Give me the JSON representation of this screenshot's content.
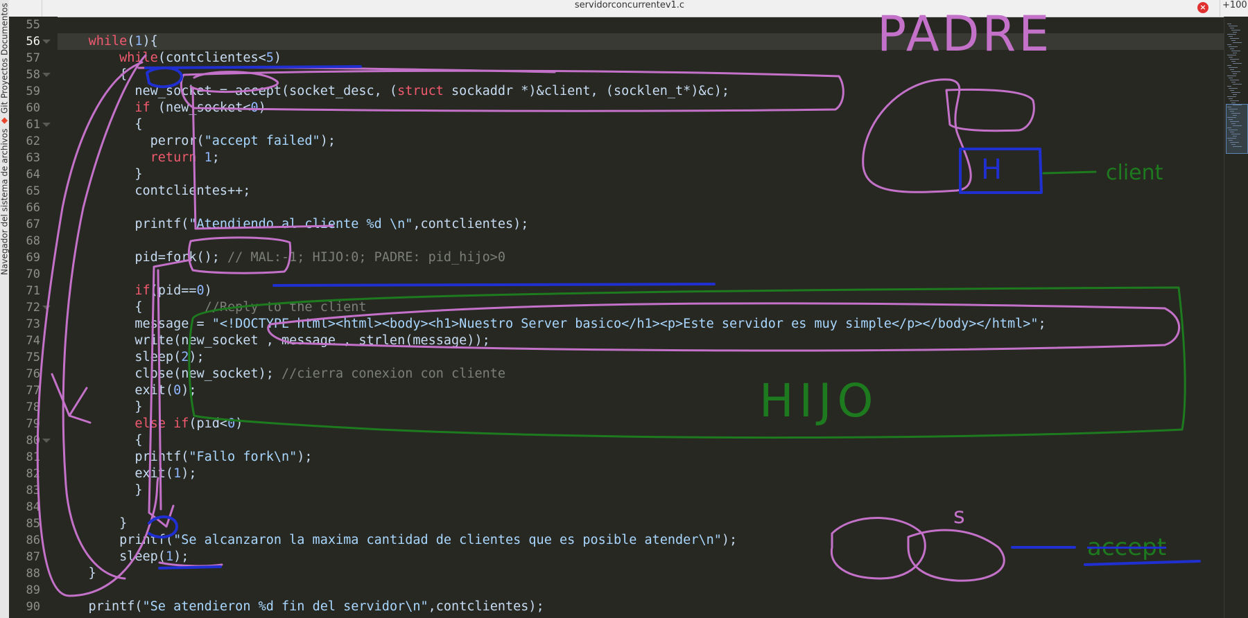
{
  "sidebar": {
    "tabs": [
      "Navegador del sistema de archivos",
      "Git",
      "Proyectos",
      "Documentos"
    ]
  },
  "titlebar": {
    "file_title": "servidorconcurrentev1.c",
    "close_label": "×",
    "zoom": "+100"
  },
  "editor": {
    "current_line": 56,
    "lines": [
      {
        "n": 55,
        "fold": false,
        "segs": []
      },
      {
        "n": 56,
        "fold": true,
        "segs": [
          [
            "    ",
            "pl"
          ],
          [
            "while",
            "kw"
          ],
          [
            "(",
            "pl"
          ],
          [
            "1",
            "nu"
          ],
          [
            "){",
            "pl"
          ]
        ]
      },
      {
        "n": 57,
        "fold": false,
        "segs": [
          [
            "        ",
            "pl"
          ],
          [
            "while",
            "kw"
          ],
          [
            "(contclientes<",
            "pl"
          ],
          [
            "5",
            "nu"
          ],
          [
            ")",
            "pl"
          ]
        ]
      },
      {
        "n": 58,
        "fold": true,
        "segs": [
          [
            "        {",
            "pl"
          ]
        ]
      },
      {
        "n": 59,
        "fold": false,
        "segs": [
          [
            "          new_socket = accept(socket_desc, (",
            "pl"
          ],
          [
            "struct",
            "kw"
          ],
          [
            " sockaddr *)&client, (socklen_t*)&c);",
            "pl"
          ]
        ]
      },
      {
        "n": 60,
        "fold": false,
        "segs": [
          [
            "          ",
            "pl"
          ],
          [
            "if",
            "kw"
          ],
          [
            " (new_socket<",
            "pl"
          ],
          [
            "0",
            "nu"
          ],
          [
            ")",
            "pl"
          ]
        ]
      },
      {
        "n": 61,
        "fold": true,
        "segs": [
          [
            "          {",
            "pl"
          ]
        ]
      },
      {
        "n": 62,
        "fold": false,
        "segs": [
          [
            "            perror(",
            "pl"
          ],
          [
            "\"accept failed\"",
            "st"
          ],
          [
            ");",
            "pl"
          ]
        ]
      },
      {
        "n": 63,
        "fold": false,
        "segs": [
          [
            "            ",
            "pl"
          ],
          [
            "return",
            "kw"
          ],
          [
            " ",
            "pl"
          ],
          [
            "1",
            "nu"
          ],
          [
            ";",
            "pl"
          ]
        ]
      },
      {
        "n": 64,
        "fold": false,
        "segs": [
          [
            "          }",
            "pl"
          ]
        ]
      },
      {
        "n": 65,
        "fold": false,
        "segs": [
          [
            "          contclientes++;",
            "pl"
          ]
        ]
      },
      {
        "n": 66,
        "fold": false,
        "segs": []
      },
      {
        "n": 67,
        "fold": false,
        "segs": [
          [
            "          printf(",
            "pl"
          ],
          [
            "\"Atendiendo al cliente %d \\n\"",
            "st"
          ],
          [
            ",contclientes);",
            "pl"
          ]
        ]
      },
      {
        "n": 68,
        "fold": false,
        "segs": []
      },
      {
        "n": 69,
        "fold": false,
        "segs": [
          [
            "          pid=fork(); ",
            "pl"
          ],
          [
            "// MAL:-1; HIJO:0; PADRE: pid_hijo>0",
            "cm"
          ]
        ]
      },
      {
        "n": 70,
        "fold": false,
        "segs": []
      },
      {
        "n": 71,
        "fold": false,
        "segs": [
          [
            "          ",
            "pl"
          ],
          [
            "if",
            "kw"
          ],
          [
            "(pid==",
            "pl"
          ],
          [
            "0",
            "nu"
          ],
          [
            ")",
            "pl"
          ]
        ]
      },
      {
        "n": 72,
        "fold": true,
        "segs": [
          [
            "          {        ",
            "pl"
          ],
          [
            "//Reply to the client",
            "cm"
          ]
        ]
      },
      {
        "n": 73,
        "fold": false,
        "segs": [
          [
            "          message = ",
            "pl"
          ],
          [
            "\"<!DOCTYPE html><html><body><h1>Nuestro Server basico</h1><p>Este servidor es muy simple</p></body></html>\"",
            "st"
          ],
          [
            ";",
            "pl"
          ]
        ]
      },
      {
        "n": 74,
        "fold": false,
        "segs": [
          [
            "          write(new_socket , message , strlen(message));",
            "pl"
          ]
        ]
      },
      {
        "n": 75,
        "fold": false,
        "segs": [
          [
            "          sleep(",
            "pl"
          ],
          [
            "2",
            "nu"
          ],
          [
            ");",
            "pl"
          ]
        ]
      },
      {
        "n": 76,
        "fold": false,
        "segs": [
          [
            "          close(new_socket); ",
            "pl"
          ],
          [
            "//cierra conexion con cliente",
            "cm"
          ]
        ]
      },
      {
        "n": 77,
        "fold": false,
        "segs": [
          [
            "          exit(",
            "pl"
          ],
          [
            "0",
            "nu"
          ],
          [
            ");",
            "pl"
          ]
        ]
      },
      {
        "n": 78,
        "fold": false,
        "segs": [
          [
            "          }",
            "pl"
          ]
        ]
      },
      {
        "n": 79,
        "fold": false,
        "segs": [
          [
            "          ",
            "pl"
          ],
          [
            "else",
            "kw"
          ],
          [
            " ",
            "pl"
          ],
          [
            "if",
            "kw"
          ],
          [
            "(pid<",
            "pl"
          ],
          [
            "0",
            "nu"
          ],
          [
            ")",
            "pl"
          ]
        ]
      },
      {
        "n": 80,
        "fold": true,
        "segs": [
          [
            "          {",
            "pl"
          ]
        ]
      },
      {
        "n": 81,
        "fold": false,
        "segs": [
          [
            "          printf(",
            "pl"
          ],
          [
            "\"Fallo fork\\n\"",
            "st"
          ],
          [
            ");",
            "pl"
          ]
        ]
      },
      {
        "n": 82,
        "fold": false,
        "segs": [
          [
            "          exit(",
            "pl"
          ],
          [
            "1",
            "nu"
          ],
          [
            ");",
            "pl"
          ]
        ]
      },
      {
        "n": 83,
        "fold": false,
        "segs": [
          [
            "          }",
            "pl"
          ]
        ]
      },
      {
        "n": 84,
        "fold": false,
        "segs": []
      },
      {
        "n": 85,
        "fold": false,
        "segs": [
          [
            "        }",
            "pl"
          ]
        ]
      },
      {
        "n": 86,
        "fold": false,
        "segs": [
          [
            "        printf(",
            "pl"
          ],
          [
            "\"Se alcanzaron la maxima cantidad de clientes que es posible atender\\n\"",
            "st"
          ],
          [
            ");",
            "pl"
          ]
        ]
      },
      {
        "n": 87,
        "fold": false,
        "segs": [
          [
            "        sleep(",
            "pl"
          ],
          [
            "1",
            "nu"
          ],
          [
            ");",
            "pl"
          ]
        ]
      },
      {
        "n": 88,
        "fold": false,
        "segs": [
          [
            "    }",
            "pl"
          ]
        ]
      },
      {
        "n": 89,
        "fold": false,
        "segs": []
      },
      {
        "n": 90,
        "fold": false,
        "segs": [
          [
            "    printf(",
            "pl"
          ],
          [
            "\"Se atendieron %d fin del servidor\\n\"",
            "st"
          ],
          [
            ",contclientes);",
            "pl"
          ]
        ]
      }
    ]
  },
  "annotations": {
    "padre": "PADRE",
    "hijo": "HIJO",
    "h": "H",
    "s": "s",
    "client": "client",
    "accept": "accept",
    "colors": {
      "pink": "#c472c9",
      "blue": "#1f2fd0",
      "green": "#1e7a1e"
    }
  }
}
